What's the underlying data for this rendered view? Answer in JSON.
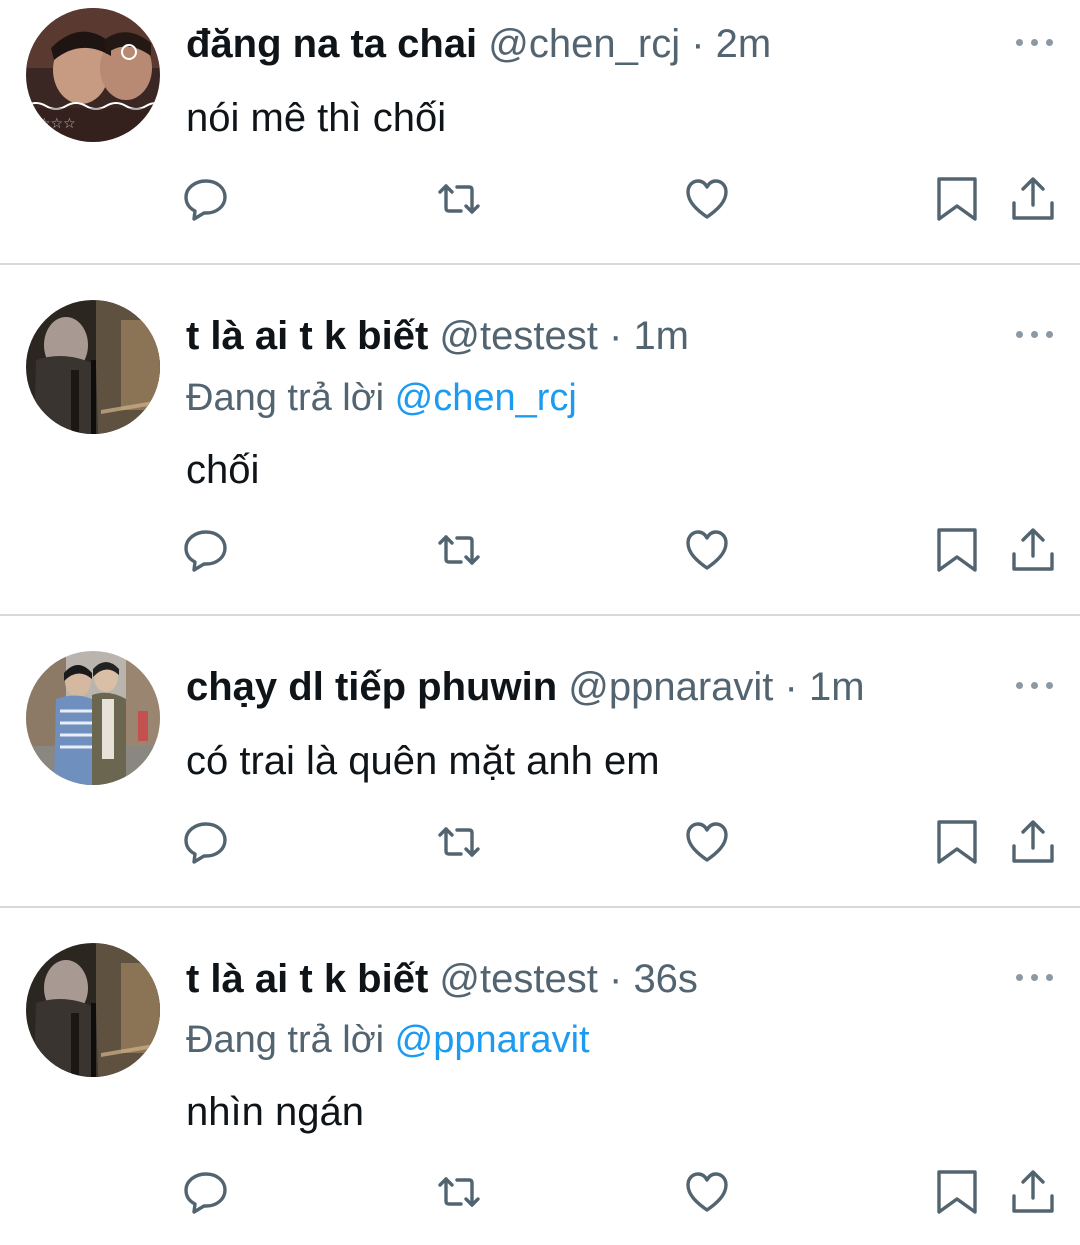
{
  "tweets": [
    {
      "name": "đăng na ta chai",
      "handle": "@chen_rcj",
      "sep": "·",
      "time": "2m",
      "replying_prefix": "",
      "replying_to": "",
      "text": "nói mê thì chối"
    },
    {
      "name": "t là ai t k biết",
      "handle": "@testest",
      "sep": "·",
      "time": "1m",
      "replying_prefix": "Đang trả lời",
      "replying_to": "@chen_rcj",
      "text": "chối"
    },
    {
      "name": "chạy dl tiếp phuwin",
      "handle": "@ppnaravit",
      "sep": "·",
      "time": "1m",
      "replying_prefix": "",
      "replying_to": "",
      "text": "có trai là quên mặt anh em"
    },
    {
      "name": "t là ai t k biết",
      "handle": "@testest",
      "sep": "·",
      "time": "36s",
      "replying_prefix": "Đang trả lời",
      "replying_to": "@ppnaravit",
      "text": "nhìn ngán"
    }
  ],
  "icons": {
    "reply": "reply-icon",
    "retweet": "retweet-icon",
    "like": "like-icon",
    "bookmark": "bookmark-icon",
    "share": "share-icon",
    "more": "more-icon"
  },
  "colors": {
    "text": "#0f1419",
    "secondary": "#536471",
    "mention": "#1d9bf0",
    "icon": "#536471",
    "divider": "#d5dadf"
  }
}
